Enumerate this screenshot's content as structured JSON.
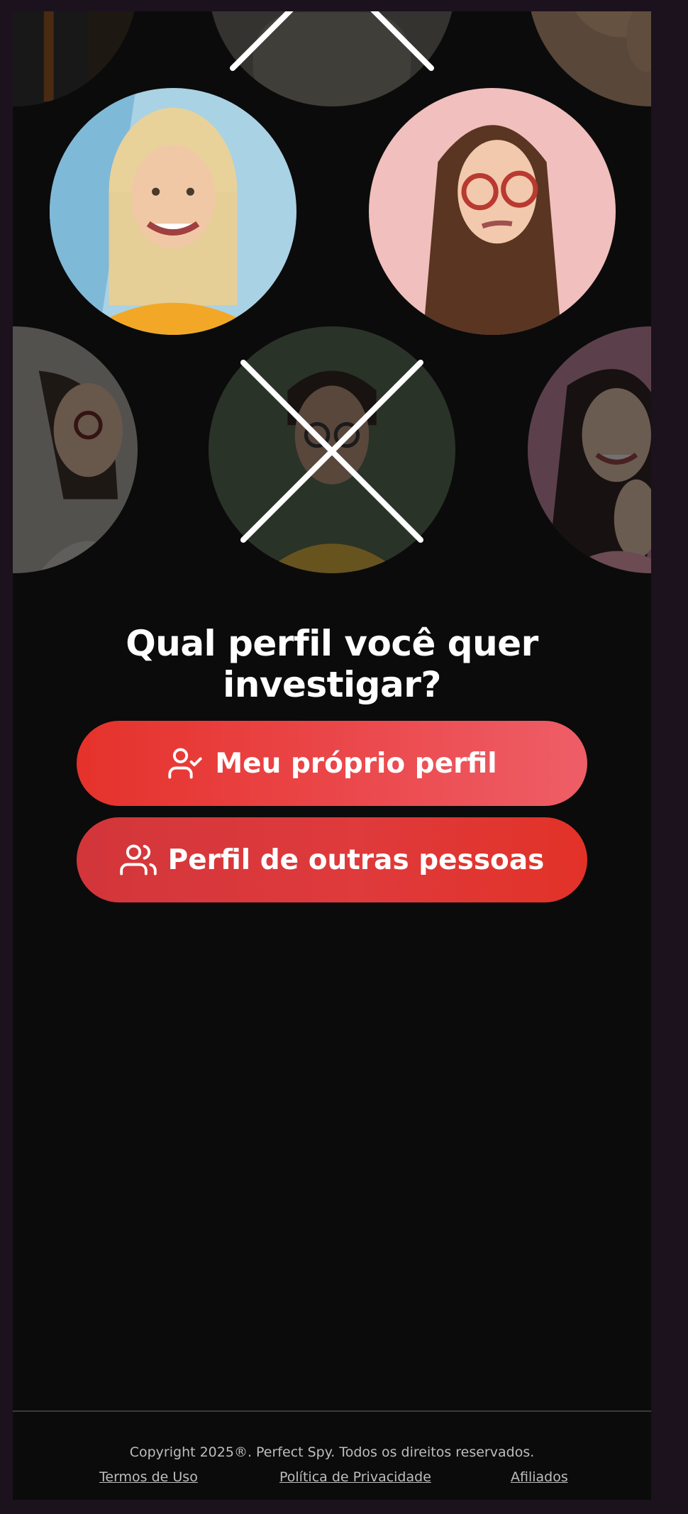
{
  "heading": {
    "line1": "Qual perfil você quer",
    "line2": "investigar?"
  },
  "buttons": {
    "own_profile": {
      "label": "Meu próprio perfil",
      "icon": "user-check-icon"
    },
    "others_profile": {
      "label": "Perfil de outras pessoas",
      "icon": "users-icon"
    }
  },
  "portraits": {
    "icon": "portrait-photo",
    "crossed_icon": "x-mark-icon"
  },
  "footer": {
    "copyright": "Copyright 2025®. Perfect Spy. Todos os direitos reservados.",
    "links": {
      "terms": "Termos de Uso",
      "privacy": "Política de Privacidade",
      "affiliates": "Afiliados"
    }
  },
  "colors": {
    "background": "#0b0b0b",
    "page_frame": "#1c121e",
    "accent_red": "#e5322b",
    "accent_pink": "#ee5e67",
    "text": "#ffffff",
    "muted_text": "#bdbdbd"
  }
}
